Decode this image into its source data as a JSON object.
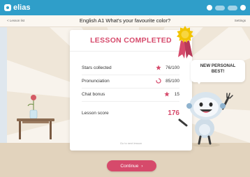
{
  "app": {
    "logo_text": "elias"
  },
  "subheader": {
    "back_label": "< Lesson list",
    "lesson_title": "English A1   What's your favourite color?",
    "settings_label": "Settings"
  },
  "card": {
    "title": "LESSON COMPLETED",
    "rows": [
      {
        "label": "Stars collected",
        "icon": "star-icon",
        "value": "76/100"
      },
      {
        "label": "Pronunciation",
        "icon": "refresh-icon",
        "value": "85/100"
      },
      {
        "label": "Chat bonus",
        "icon": "star-icon",
        "value": "15"
      }
    ],
    "score_label": "Lesson score",
    "score_value": "176",
    "footer": "Go to next lesson"
  },
  "speech": {
    "line1": "NEW PERSONAL",
    "line2": "BEST!"
  },
  "continue_label": "Continue",
  "colors": {
    "brand": "#2f9ec9",
    "accent": "#d64a6b",
    "medal": "#f2c400"
  }
}
